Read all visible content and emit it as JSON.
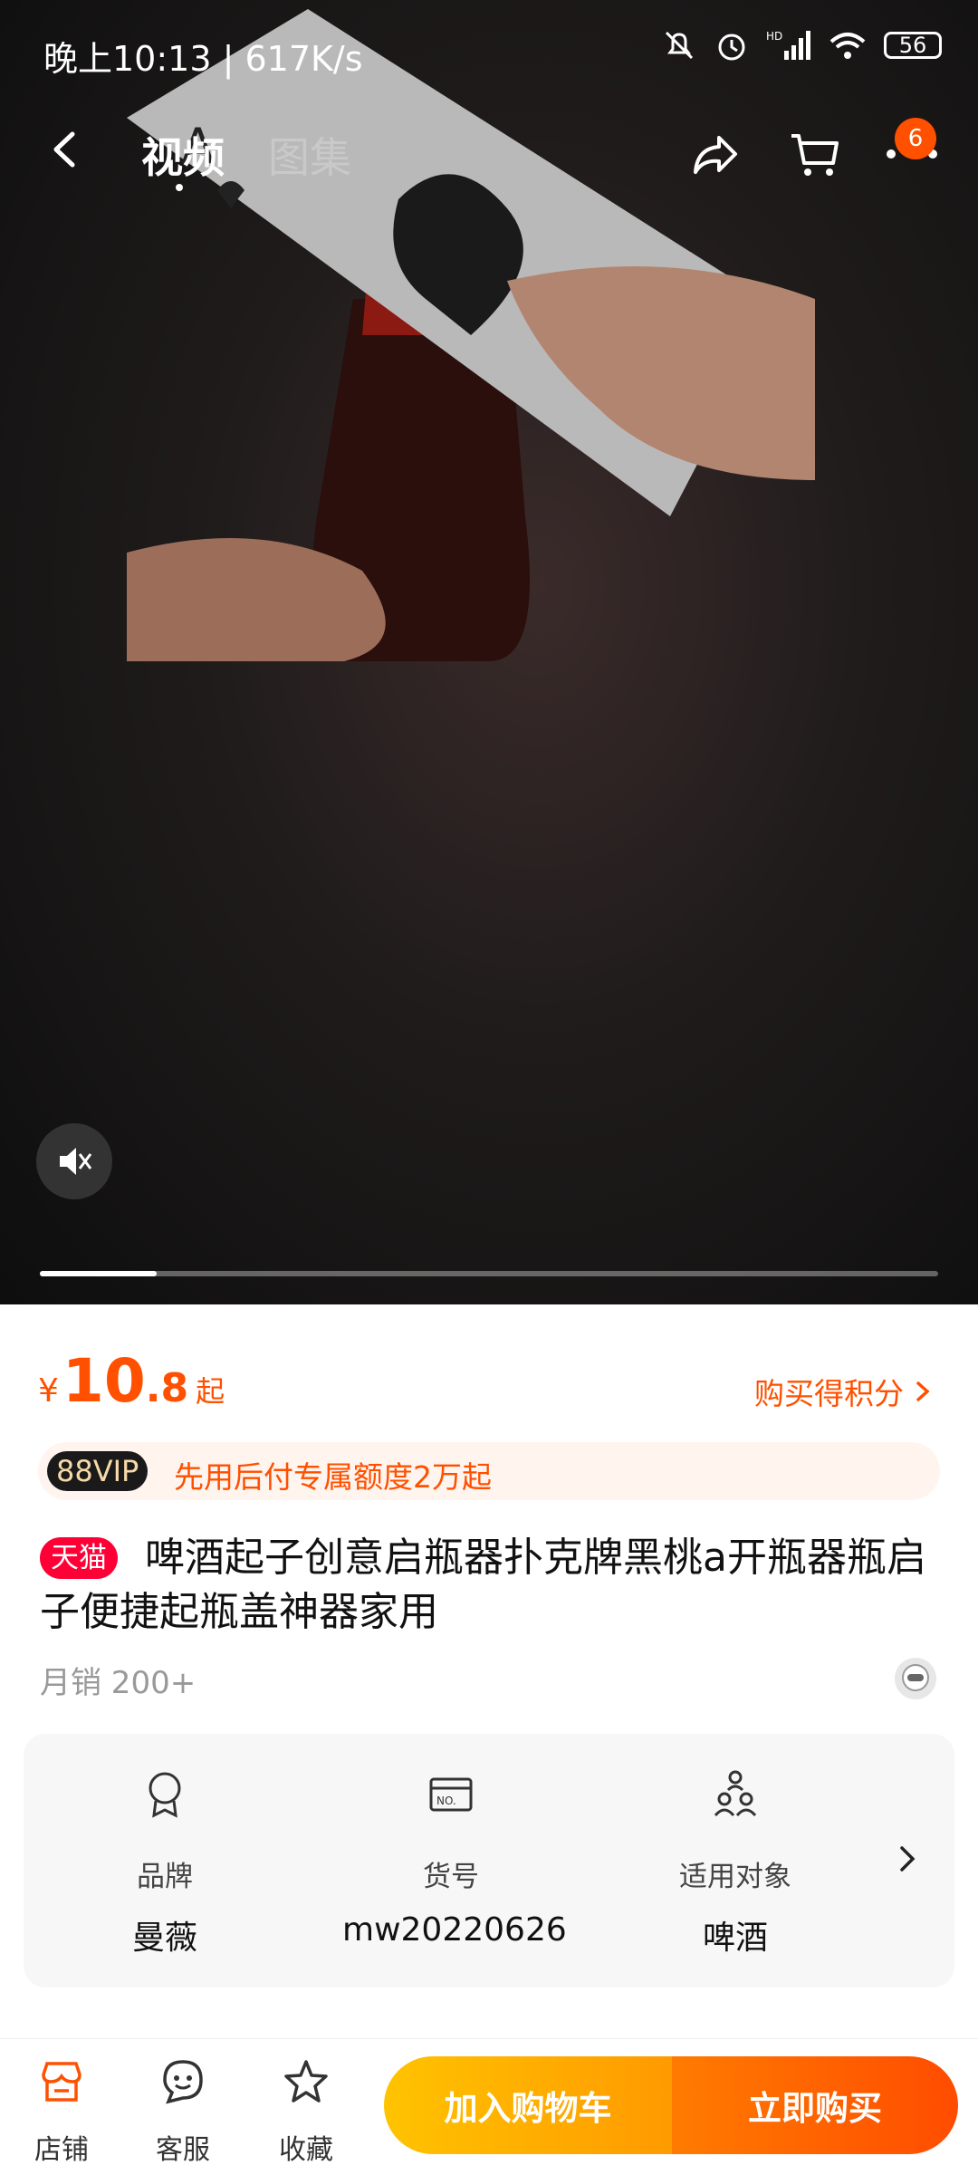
{
  "status": {
    "time": "晚上10:13 | 617K/s",
    "battery": "56"
  },
  "header": {
    "tabs": [
      {
        "label": "视频",
        "active": true
      },
      {
        "label": "图集",
        "active": false
      }
    ],
    "cart_badge": "6"
  },
  "media": {
    "progress": 0.13
  },
  "product": {
    "price_symbol": "¥",
    "price_int": "10",
    "price_dec": ".8",
    "price_suffix": "起",
    "points_label": "购买得积分",
    "vip_tag": "88VIP",
    "vip_text": "先用后付专属额度2万起",
    "store_tag": "天猫",
    "title": "啤酒起子创意启瓶器扑克牌黑桃a开瓶器瓶启子便捷起瓶盖神器家用",
    "sales": "月销 200+"
  },
  "params": [
    {
      "label": "品牌",
      "value": "曼薇",
      "icon": "medal-icon"
    },
    {
      "label": "货号",
      "value": "mw20220626",
      "icon": "box-icon"
    },
    {
      "label": "适用对象",
      "value": "啤酒",
      "icon": "people-icon"
    }
  ],
  "bottom_nav": [
    {
      "label": "店铺",
      "icon": "store-icon"
    },
    {
      "label": "客服",
      "icon": "service-icon"
    },
    {
      "label": "收藏",
      "icon": "star-icon"
    }
  ],
  "actions": {
    "add_to_cart": "加入购物车",
    "buy_now": "立即购买"
  },
  "colors": {
    "accent": "#ff5000",
    "tmall": "#ff0036"
  }
}
